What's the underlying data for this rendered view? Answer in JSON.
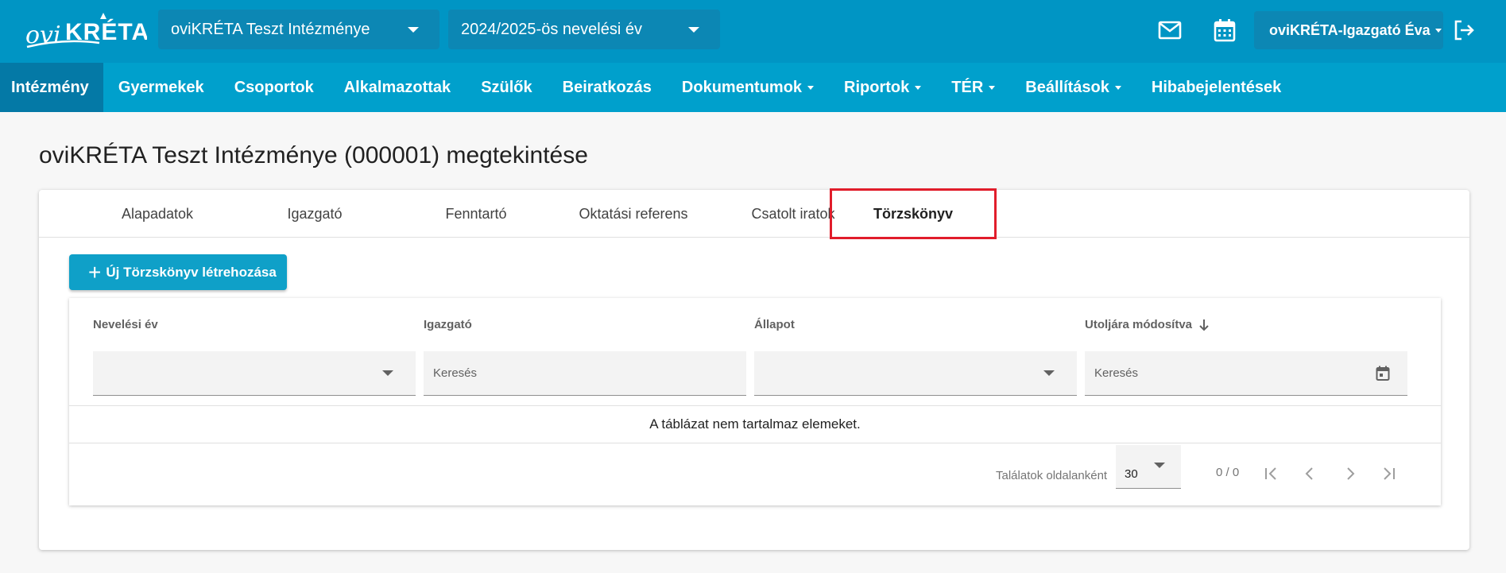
{
  "header": {
    "logo_text": "oviKRÉTA",
    "institution_select": "oviKRÉTA Teszt Intézménye",
    "year_select": "2024/2025-ös nevelési év",
    "user": "oviKRÉTA-Igazgató Éva",
    "icons": [
      "mail-icon",
      "calendar-icon",
      "logout-icon"
    ]
  },
  "nav": [
    {
      "label": "Intézmény",
      "active": true,
      "dropdown": false
    },
    {
      "label": "Gyermekek",
      "dropdown": false
    },
    {
      "label": "Csoportok",
      "dropdown": false
    },
    {
      "label": "Alkalmazottak",
      "dropdown": false
    },
    {
      "label": "Szülők",
      "dropdown": false
    },
    {
      "label": "Beiratkozás",
      "dropdown": false
    },
    {
      "label": "Dokumentumok",
      "dropdown": true
    },
    {
      "label": "Riportok",
      "dropdown": true
    },
    {
      "label": "TÉR",
      "dropdown": true
    },
    {
      "label": "Beállítások",
      "dropdown": true
    },
    {
      "label": "Hibabejelentések",
      "dropdown": false
    }
  ],
  "page": {
    "title": "oviKRÉTA Teszt Intézménye (000001) megtekintése"
  },
  "tabs": [
    {
      "label": "Alapadatok"
    },
    {
      "label": "Igazgató"
    },
    {
      "label": "Fenntartó"
    },
    {
      "label": "Oktatási referens"
    },
    {
      "label": "Csatolt iratok"
    },
    {
      "label": "Törzskönyv",
      "active": true,
      "highlighted": true
    }
  ],
  "actions": {
    "new_button": "Új Törzskönyv létrehozása"
  },
  "table": {
    "columns": [
      {
        "label": "Nevelési év",
        "filter_type": "select",
        "filter_value": ""
      },
      {
        "label": "Igazgató",
        "filter_type": "text",
        "filter_placeholder": "Keresés"
      },
      {
        "label": "Állapot",
        "filter_type": "select",
        "filter_value": ""
      },
      {
        "label": "Utoljára módosítva",
        "filter_type": "date",
        "filter_placeholder": "Keresés",
        "sort": "desc"
      }
    ],
    "empty_message": "A táblázat nem tartalmaz elemeket.",
    "pagination": {
      "page_size_label": "Találatok oldalanként",
      "page_size": "30",
      "range": "0 / 0"
    }
  },
  "colors": {
    "header_bg": "#0095c4",
    "nav_bg": "#00a0cc",
    "nav_active_bg": "#0479a6",
    "button_bg": "#0fa0c8",
    "highlight_border": "#e11d2b"
  }
}
